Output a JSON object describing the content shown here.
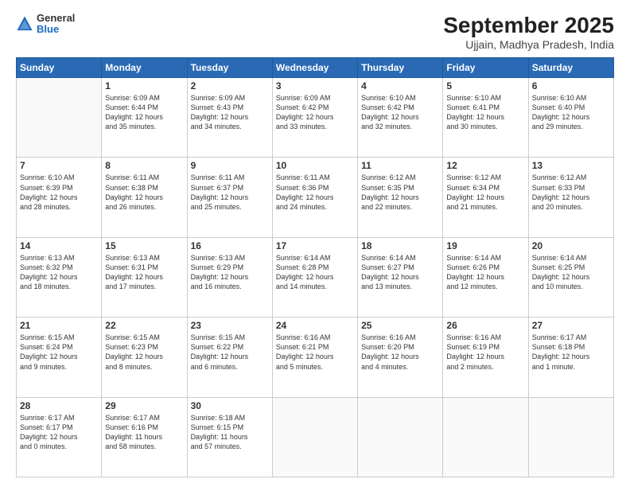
{
  "logo": {
    "general": "General",
    "blue": "Blue"
  },
  "title": "September 2025",
  "location": "Ujjain, Madhya Pradesh, India",
  "days_header": [
    "Sunday",
    "Monday",
    "Tuesday",
    "Wednesday",
    "Thursday",
    "Friday",
    "Saturday"
  ],
  "weeks": [
    [
      {
        "day": "",
        "info": ""
      },
      {
        "day": "1",
        "info": "Sunrise: 6:09 AM\nSunset: 6:44 PM\nDaylight: 12 hours\nand 35 minutes."
      },
      {
        "day": "2",
        "info": "Sunrise: 6:09 AM\nSunset: 6:43 PM\nDaylight: 12 hours\nand 34 minutes."
      },
      {
        "day": "3",
        "info": "Sunrise: 6:09 AM\nSunset: 6:42 PM\nDaylight: 12 hours\nand 33 minutes."
      },
      {
        "day": "4",
        "info": "Sunrise: 6:10 AM\nSunset: 6:42 PM\nDaylight: 12 hours\nand 32 minutes."
      },
      {
        "day": "5",
        "info": "Sunrise: 6:10 AM\nSunset: 6:41 PM\nDaylight: 12 hours\nand 30 minutes."
      },
      {
        "day": "6",
        "info": "Sunrise: 6:10 AM\nSunset: 6:40 PM\nDaylight: 12 hours\nand 29 minutes."
      }
    ],
    [
      {
        "day": "7",
        "info": "Sunrise: 6:10 AM\nSunset: 6:39 PM\nDaylight: 12 hours\nand 28 minutes."
      },
      {
        "day": "8",
        "info": "Sunrise: 6:11 AM\nSunset: 6:38 PM\nDaylight: 12 hours\nand 26 minutes."
      },
      {
        "day": "9",
        "info": "Sunrise: 6:11 AM\nSunset: 6:37 PM\nDaylight: 12 hours\nand 25 minutes."
      },
      {
        "day": "10",
        "info": "Sunrise: 6:11 AM\nSunset: 6:36 PM\nDaylight: 12 hours\nand 24 minutes."
      },
      {
        "day": "11",
        "info": "Sunrise: 6:12 AM\nSunset: 6:35 PM\nDaylight: 12 hours\nand 22 minutes."
      },
      {
        "day": "12",
        "info": "Sunrise: 6:12 AM\nSunset: 6:34 PM\nDaylight: 12 hours\nand 21 minutes."
      },
      {
        "day": "13",
        "info": "Sunrise: 6:12 AM\nSunset: 6:33 PM\nDaylight: 12 hours\nand 20 minutes."
      }
    ],
    [
      {
        "day": "14",
        "info": "Sunrise: 6:13 AM\nSunset: 6:32 PM\nDaylight: 12 hours\nand 18 minutes."
      },
      {
        "day": "15",
        "info": "Sunrise: 6:13 AM\nSunset: 6:31 PM\nDaylight: 12 hours\nand 17 minutes."
      },
      {
        "day": "16",
        "info": "Sunrise: 6:13 AM\nSunset: 6:29 PM\nDaylight: 12 hours\nand 16 minutes."
      },
      {
        "day": "17",
        "info": "Sunrise: 6:14 AM\nSunset: 6:28 PM\nDaylight: 12 hours\nand 14 minutes."
      },
      {
        "day": "18",
        "info": "Sunrise: 6:14 AM\nSunset: 6:27 PM\nDaylight: 12 hours\nand 13 minutes."
      },
      {
        "day": "19",
        "info": "Sunrise: 6:14 AM\nSunset: 6:26 PM\nDaylight: 12 hours\nand 12 minutes."
      },
      {
        "day": "20",
        "info": "Sunrise: 6:14 AM\nSunset: 6:25 PM\nDaylight: 12 hours\nand 10 minutes."
      }
    ],
    [
      {
        "day": "21",
        "info": "Sunrise: 6:15 AM\nSunset: 6:24 PM\nDaylight: 12 hours\nand 9 minutes."
      },
      {
        "day": "22",
        "info": "Sunrise: 6:15 AM\nSunset: 6:23 PM\nDaylight: 12 hours\nand 8 minutes."
      },
      {
        "day": "23",
        "info": "Sunrise: 6:15 AM\nSunset: 6:22 PM\nDaylight: 12 hours\nand 6 minutes."
      },
      {
        "day": "24",
        "info": "Sunrise: 6:16 AM\nSunset: 6:21 PM\nDaylight: 12 hours\nand 5 minutes."
      },
      {
        "day": "25",
        "info": "Sunrise: 6:16 AM\nSunset: 6:20 PM\nDaylight: 12 hours\nand 4 minutes."
      },
      {
        "day": "26",
        "info": "Sunrise: 6:16 AM\nSunset: 6:19 PM\nDaylight: 12 hours\nand 2 minutes."
      },
      {
        "day": "27",
        "info": "Sunrise: 6:17 AM\nSunset: 6:18 PM\nDaylight: 12 hours\nand 1 minute."
      }
    ],
    [
      {
        "day": "28",
        "info": "Sunrise: 6:17 AM\nSunset: 6:17 PM\nDaylight: 12 hours\nand 0 minutes."
      },
      {
        "day": "29",
        "info": "Sunrise: 6:17 AM\nSunset: 6:16 PM\nDaylight: 11 hours\nand 58 minutes."
      },
      {
        "day": "30",
        "info": "Sunrise: 6:18 AM\nSunset: 6:15 PM\nDaylight: 11 hours\nand 57 minutes."
      },
      {
        "day": "",
        "info": ""
      },
      {
        "day": "",
        "info": ""
      },
      {
        "day": "",
        "info": ""
      },
      {
        "day": "",
        "info": ""
      }
    ]
  ]
}
